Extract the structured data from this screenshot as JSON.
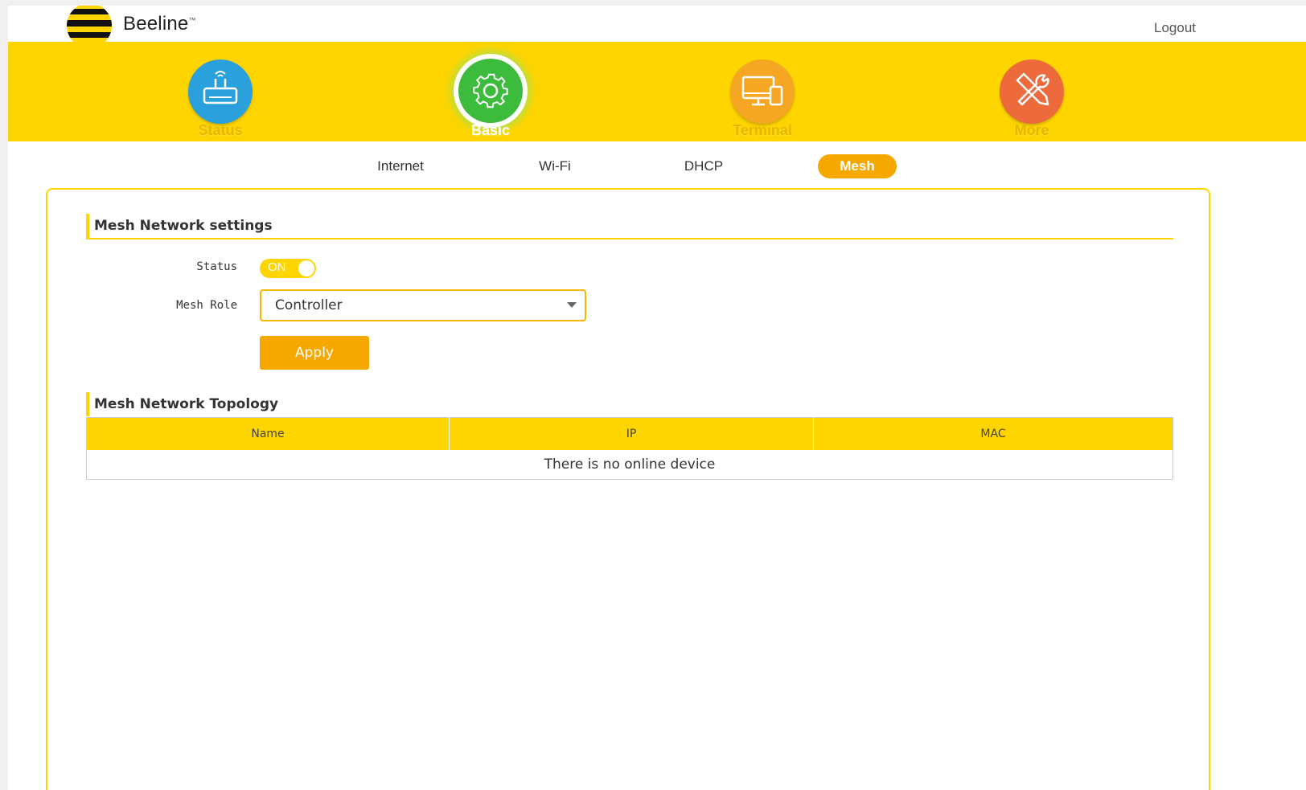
{
  "brand": {
    "name": "Beeline",
    "tm": "™"
  },
  "header": {
    "logout_label": "Logout"
  },
  "nav": {
    "items": [
      {
        "label": "Status",
        "icon": "router-icon",
        "color": "#2aa0dc"
      },
      {
        "label": "Basic",
        "icon": "gear-icon",
        "color": "#3dbb3d",
        "active": true
      },
      {
        "label": "Terminal",
        "icon": "devices-icon",
        "color": "#f5a623"
      },
      {
        "label": "More",
        "icon": "tools-icon",
        "color": "#ec6a3c"
      }
    ]
  },
  "subtabs": {
    "items": [
      {
        "label": "Internet"
      },
      {
        "label": "Wi-Fi"
      },
      {
        "label": "DHCP"
      },
      {
        "label": "Mesh",
        "active": true
      }
    ]
  },
  "settings": {
    "title": "Mesh Network settings",
    "status_label": "Status",
    "status_value": "ON",
    "role_label": "Mesh Role",
    "role_value": "Controller",
    "apply_label": "Apply"
  },
  "topology": {
    "title": "Mesh Network Topology",
    "columns": [
      "Name",
      "IP",
      "MAC"
    ],
    "empty_text": "There is no online device"
  },
  "colors": {
    "accent_yellow": "#ffd500",
    "accent_orange": "#f5a800"
  }
}
